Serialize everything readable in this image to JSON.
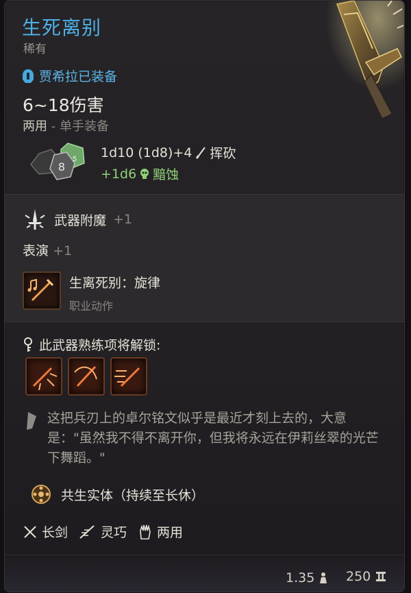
{
  "item": {
    "name": "生死离别",
    "rarity": "稀有",
    "equipped_by": "贾希拉已装备",
    "damage": "6~18伤害",
    "handedness": "两用",
    "handedness_detail": " - 单手装备",
    "damage_line1": "1d10 (1d8)+4",
    "damage_type1": "挥砍",
    "damage_line2": "+1d6",
    "damage_type2": "黯蚀",
    "dice_labels": [
      "8",
      "5"
    ]
  },
  "effects": {
    "enchant_label": "武器附魔",
    "enchant_value": "+1",
    "perform_label": "表演",
    "perform_value": "+1",
    "action_name": "生离死别：旋律",
    "action_type": "职业动作"
  },
  "proficiency": {
    "unlock_text": "此武器熟练项将解锁:",
    "skills": [
      "skill-1",
      "skill-2",
      "skill-3"
    ]
  },
  "lore": {
    "text": "这把兵刃上的卓尔铭文似乎是最近才刻上去的，大意是：\"虽然我不得不离开你，但我将永远在伊莉丝翠的光芒下舞蹈。\""
  },
  "passive": {
    "label": "共生实体（持续至长休）"
  },
  "properties": {
    "type": "长剑",
    "finesse": "灵巧",
    "versatile": "两用"
  },
  "footer": {
    "weight": "1.35",
    "value": "250"
  },
  "colors": {
    "title": "#4fb0e8",
    "equip": "#5db6e8",
    "necrotic": "#8fd07a",
    "muted": "#8b8580"
  }
}
